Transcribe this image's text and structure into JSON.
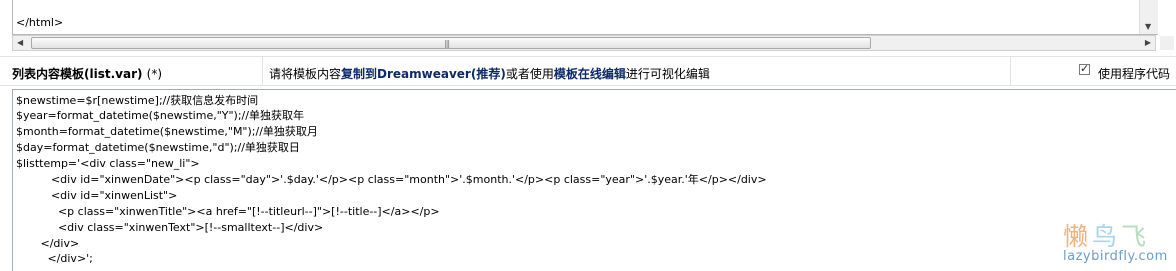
{
  "top_editor": {
    "visible_code": "</html>"
  },
  "template_row": {
    "label": "列表内容模板(list.var)",
    "required_marker": "(*)",
    "instruction_prefix": "请将模板内容",
    "instruction_copy_link": "复制到Dreamweaver(推荐)",
    "instruction_middle": "或者使用",
    "instruction_edit_link": "模板在线编辑",
    "instruction_suffix": "进行可视化编辑",
    "use_code_checked": true,
    "use_code_label": "使用程序代码"
  },
  "code_lines": [
    "$newstime=$r[newstime];//获取信息发布时间",
    "$year=format_datetime($newstime,\"Y\");//单独获取年",
    "$month=format_datetime($newstime,\"M\");//单独获取月",
    "$day=format_datetime($newstime,\"d\");//单独获取日",
    "$listtemp='<div class=\"new_li\">",
    "          <div id=\"xinwenDate\"><p class=\"day\">'.$day.'</p><p class=\"month\">'.$month.'</p><p class=\"year\">'.$year.'年</p></div>",
    "          <div id=\"xinwenList\">",
    "            <p class=\"xinwenTitle\"><a href=\"[!--titleurl--]\">[!--title--]</a></p>",
    "            <div class=\"xinwenText\">[!--smalltext--]</div>",
    "       </div>",
    "         </div>';"
  ],
  "watermark": {
    "glyph_1": "懒",
    "glyph_2": "鸟",
    "glyph_3": "飞",
    "url": "lazybirdfly.com"
  },
  "scrollbar_icons": {
    "left": "arrow-left-icon",
    "right": "arrow-right-icon",
    "grip": "grip-icon",
    "down": "arrow-down-icon"
  }
}
